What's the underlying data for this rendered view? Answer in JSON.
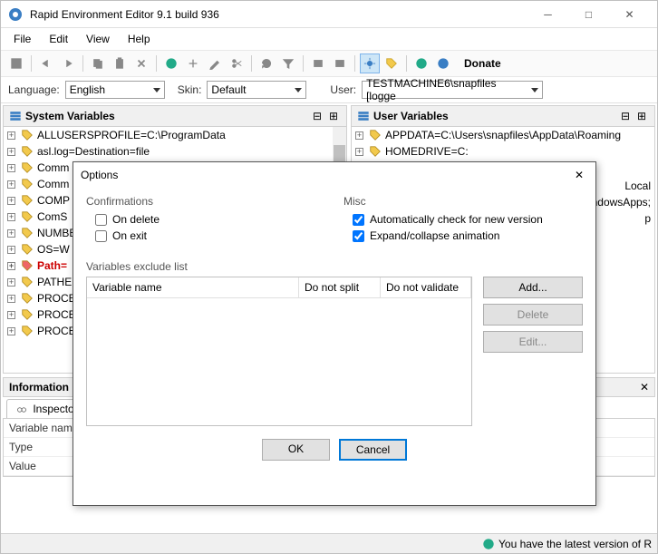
{
  "window": {
    "title": "Rapid Environment Editor 9.1 build 936"
  },
  "menubar": [
    "File",
    "Edit",
    "View",
    "Help"
  ],
  "toolbar": {
    "donate": "Donate"
  },
  "selectors": {
    "language_label": "Language:",
    "language_value": "English",
    "skin_label": "Skin:",
    "skin_value": "Default",
    "user_label": "User:",
    "user_value": "TESTMACHINE6\\snapfiles [logge"
  },
  "panes": {
    "system": {
      "title": "System Variables",
      "rows": [
        "ALLUSERSPROFILE=C:\\ProgramData",
        "asl.log=Destination=file",
        "Comm",
        "Comm",
        "COMP",
        "ComS",
        "NUMBE",
        "OS=W",
        "Path=",
        "PATHE",
        "PROCE",
        "PROCE",
        "PROCE"
      ]
    },
    "user": {
      "title": "User Variables",
      "rows": [
        "APPDATA=C:\\Users\\snapfiles\\AppData\\Roaming",
        "HOMEDRIVE=C:"
      ],
      "partial_rows": [
        "Local",
        "soft\\WindowsApps;",
        "p"
      ]
    }
  },
  "info": {
    "header": "Information",
    "tab": "Inspector",
    "labels": {
      "name": "Variable name",
      "type": "Type",
      "value": "Value"
    }
  },
  "statusbar": {
    "text": "You have the latest version of R"
  },
  "options_dialog": {
    "title": "Options",
    "confirmations": {
      "legend": "Confirmations",
      "on_delete": "On delete",
      "on_exit": "On exit"
    },
    "misc": {
      "legend": "Misc",
      "auto_check": "Automatically check for new version",
      "expand_anim": "Expand/collapse animation"
    },
    "exclude": {
      "legend": "Variables exclude list",
      "col_name": "Variable name",
      "col_nosplit": "Do not split",
      "col_novalidate": "Do not validate",
      "add": "Add...",
      "delete": "Delete",
      "edit": "Edit..."
    },
    "ok": "OK",
    "cancel": "Cancel"
  }
}
